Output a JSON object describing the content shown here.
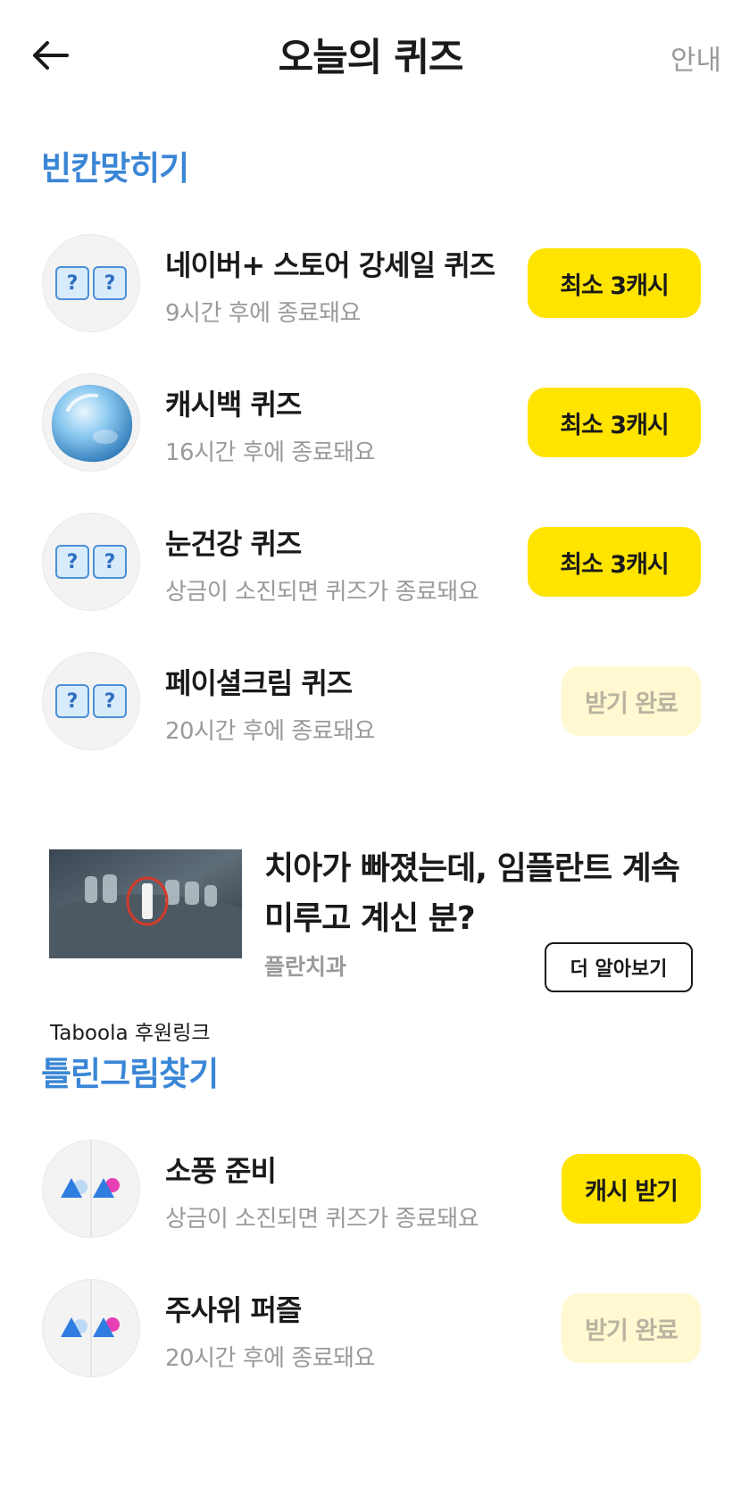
{
  "header": {
    "title": "오늘의 퀴즈",
    "guide_label": "안내"
  },
  "sections": [
    {
      "title": "빈칸맞히기",
      "items": [
        {
          "title": "네이버+ 스토어 강세일 퀴즈",
          "subtitle": "9시간 후에 종료돼요",
          "button": "최소 3캐시",
          "thumb": "question-marks-icon",
          "done": false
        },
        {
          "title": "캐시백 퀴즈",
          "subtitle": "16시간 후에 종료돼요",
          "button": "최소 3캐시",
          "thumb": "water-drop-image",
          "done": false
        },
        {
          "title": "눈건강 퀴즈",
          "subtitle": "상금이 소진되면 퀴즈가 종료돼요",
          "button": "최소 3캐시",
          "thumb": "question-marks-icon",
          "done": false
        },
        {
          "title": "페이셜크림 퀴즈",
          "subtitle": "20시간 후에 종료돼요",
          "button": "받기 완료",
          "thumb": "question-marks-icon",
          "done": true
        }
      ]
    },
    {
      "title": "틀린그림찾기",
      "items": [
        {
          "title": "소풍 준비",
          "subtitle": "상금이 소진되면 퀴즈가 종료돼요",
          "button": "캐시 받기",
          "thumb": "spot-difference-icon",
          "done": false
        },
        {
          "title": "주사위 퍼즐",
          "subtitle": "20시간 후에 종료돼요",
          "button": "받기 완료",
          "thumb": "spot-difference-icon",
          "done": true
        }
      ]
    }
  ],
  "ad": {
    "headline": "치아가 빠졌는데, 임플란트 계속 미루고 계신 분?",
    "source": "플란치과",
    "cta": "더 알아보기",
    "sponsor": "Taboola 후원링크",
    "image": "dental-xray-image"
  },
  "colors": {
    "accent_yellow": "#ffe400",
    "done_yellow": "#fff8d1",
    "section_blue": "#3a86d6",
    "muted_gray": "#9a9a9a"
  }
}
